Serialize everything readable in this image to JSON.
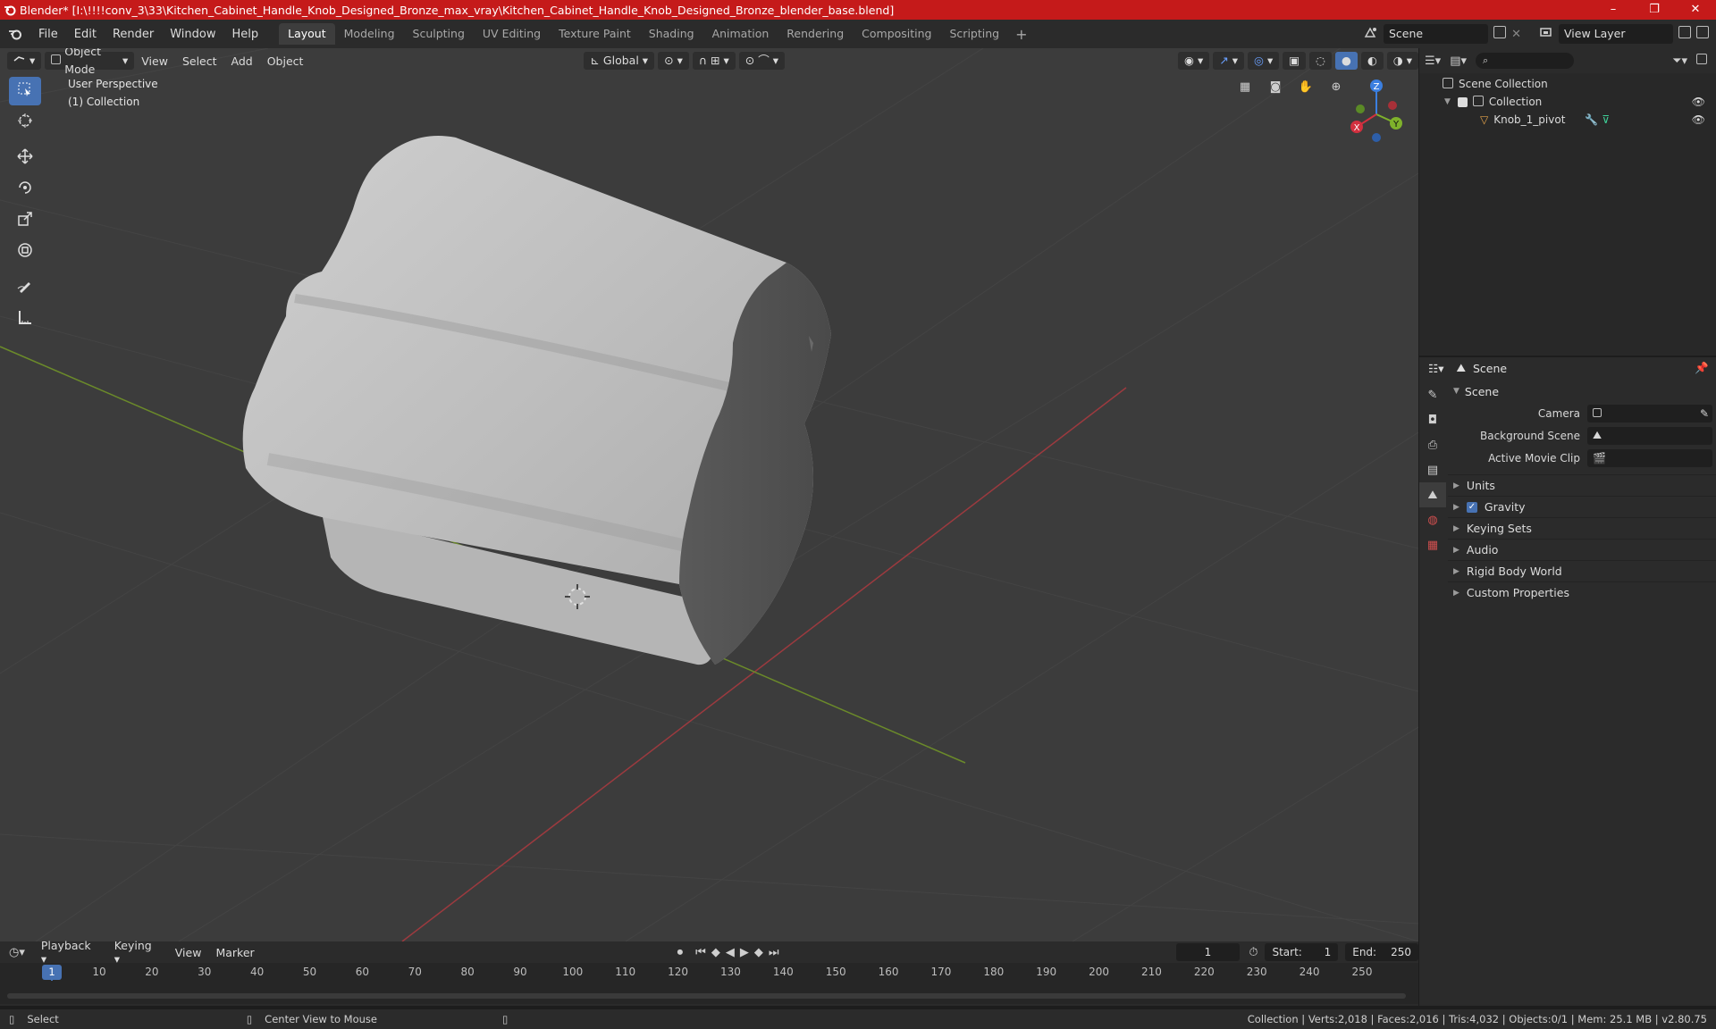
{
  "window": {
    "title": "Blender* [I:\\!!!!conv_3\\33\\Kitchen_Cabinet_Handle_Knob_Designed_Bronze_max_vray\\Kitchen_Cabinet_Handle_Knob_Designed_Bronze_blender_base.blend]",
    "controls": [
      "–",
      "❐",
      "✕"
    ]
  },
  "menu": [
    "File",
    "Edit",
    "Render",
    "Window",
    "Help"
  ],
  "workspaces": [
    "Layout",
    "Modeling",
    "Sculpting",
    "UV Editing",
    "Texture Paint",
    "Shading",
    "Animation",
    "Rendering",
    "Compositing",
    "Scripting"
  ],
  "active_workspace": "Layout",
  "scene_selector": "Scene",
  "view_layer_selector": "View Layer",
  "viewport": {
    "mode": "Object Mode",
    "menus": [
      "View",
      "Select",
      "Add",
      "Object"
    ],
    "transform_orientation": "Global",
    "info_line1": "User Perspective",
    "info_line2": "(1) Collection",
    "gizmo_labels": {
      "z": "Z",
      "y": "Y",
      "x": "X"
    }
  },
  "outliner": {
    "root": "Scene Collection",
    "collection": "Collection",
    "object": "Knob_1_pivot"
  },
  "properties": {
    "header": "Scene",
    "panel": "Scene",
    "camera_label": "Camera",
    "background_scene_label": "Background Scene",
    "active_movie_clip_label": "Active Movie Clip",
    "subpanels": [
      "Units",
      "Gravity",
      "Keying Sets",
      "Audio",
      "Rigid Body World",
      "Custom Properties"
    ],
    "gravity_checked": true
  },
  "timeline": {
    "menus": [
      "Playback",
      "Keying",
      "View",
      "Marker"
    ],
    "current_frame": "1",
    "start_label": "Start:",
    "start": "1",
    "end_label": "End:",
    "end": "250",
    "ticks": [
      "1",
      "10",
      "20",
      "30",
      "40",
      "50",
      "60",
      "70",
      "80",
      "90",
      "100",
      "110",
      "120",
      "130",
      "140",
      "150",
      "160",
      "170",
      "180",
      "190",
      "200",
      "210",
      "220",
      "230",
      "240",
      "250"
    ]
  },
  "statusbar": {
    "select": "Select",
    "center_view": "Center View to Mouse",
    "stats": "Collection | Verts:2,018 | Faces:2,016 | Tris:4,032 | Objects:0/1 | Mem: 25.1 MB | v2.80.75"
  },
  "colors": {
    "title_red": "#c51a1a",
    "accent_blue": "#4772b3",
    "axis_x": "#d2303f",
    "axis_y": "#7fb22b",
    "axis_z": "#3b7fe0"
  }
}
